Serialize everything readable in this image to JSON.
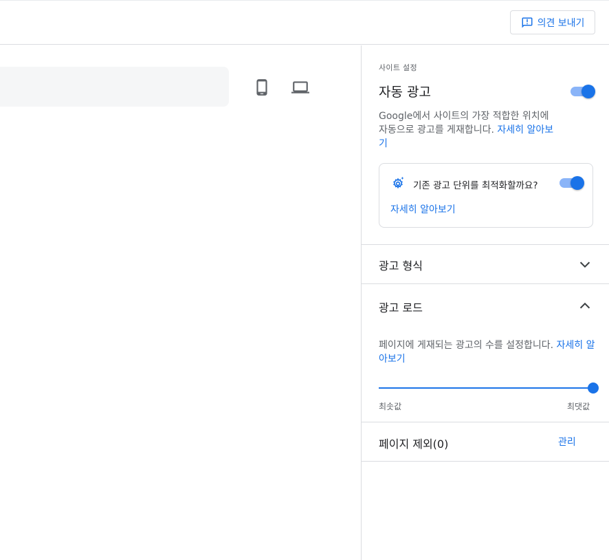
{
  "topbar": {
    "feedback_label": "의견 보내기"
  },
  "preview": {
    "devices": [
      "mobile-icon",
      "laptop-icon"
    ]
  },
  "panel": {
    "overline": "사이트 설정",
    "auto_ads": {
      "title": "자동 광고",
      "enabled": true,
      "description": "Google에서 사이트의 가장 적합한 위치에 자동으로 광고를 게재합니다.",
      "learn_more": "자세히 알아보기"
    },
    "optimize": {
      "title": "기존 광고 단위를 최적화할까요?",
      "enabled": true,
      "learn_more": "자세히 알아보기"
    },
    "ad_formats": {
      "title": "광고 형식",
      "expanded": false
    },
    "ad_load": {
      "title": "광고 로드",
      "expanded": true,
      "description": "페이지에 게재되는 광고의 수를 설정합니다.",
      "learn_more": "자세히 알아보기",
      "level_fraction": 1.0,
      "min_label": "최솟값",
      "max_label": "최댓값"
    },
    "exclusions": {
      "title": "페이지 제외(0)",
      "manage_label": "관리"
    }
  },
  "colors": {
    "accent": "#1a73e8",
    "track": "#8ab4f8",
    "divider": "#dadce0",
    "secondary_text": "#5f6368"
  }
}
